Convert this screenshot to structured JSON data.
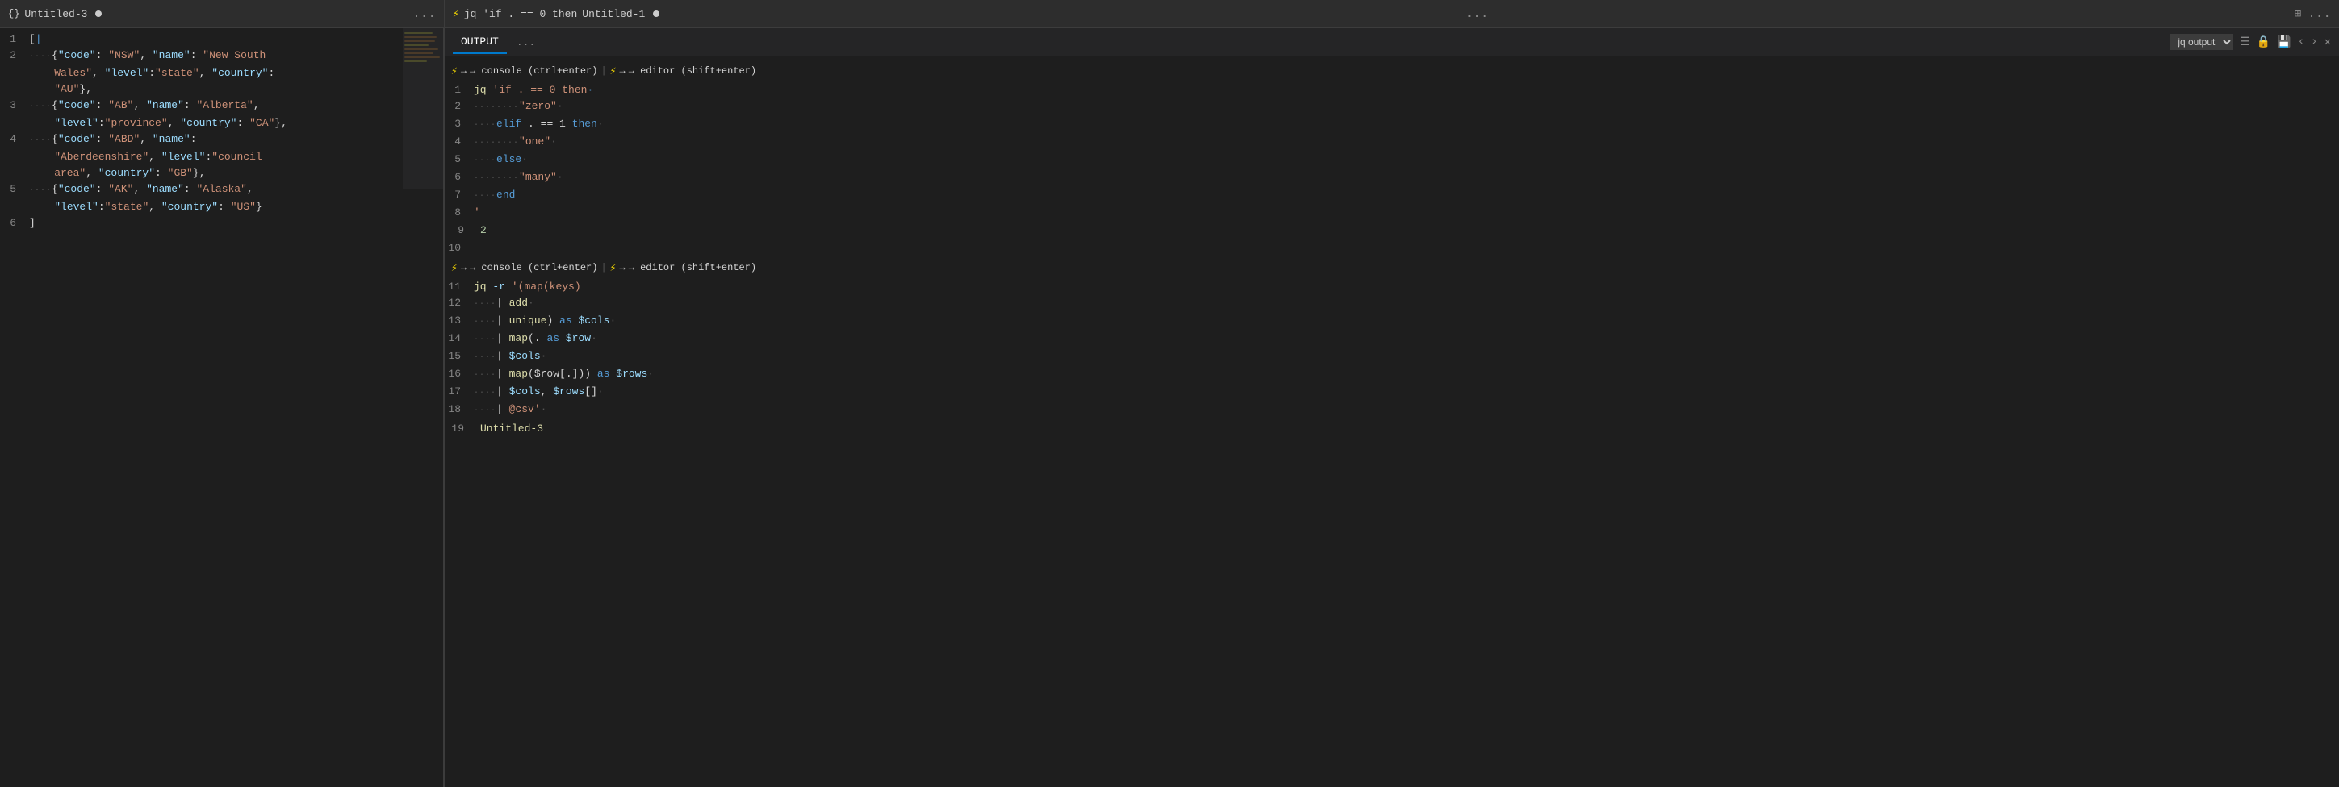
{
  "leftPanel": {
    "title": "Untitled-3",
    "modified": true,
    "icon": "{}",
    "lines": [
      {
        "num": 1,
        "content": "["
      },
      {
        "num": 2,
        "content": "    {\"code\": \"NSW\", \"name\": \"New South\\n    Wales\", \"level\":\"state\", \"country\":\\n    \"AU\"},"
      },
      {
        "num": 3,
        "content": "    {\"code\": \"AB\", \"name\": \"Alberta\",\\n    \"level\":\"province\", \"country\": \"CA\"},"
      },
      {
        "num": 4,
        "content": "    {\"code\": \"ABD\", \"name\":\\n    \"Aberdeenshire\", \"level\":\"council\\n    area\", \"country\": \"GB\"},"
      },
      {
        "num": 5,
        "content": "    {\"code\": \"AK\", \"name\": \"Alaska\",\\n    \"level\":\"state\", \"country\": \"US\"}"
      },
      {
        "num": 6,
        "content": "]"
      }
    ],
    "dotsLabel": "..."
  },
  "rightPanel": {
    "tabTitle": "jq 'if . == 0 then",
    "fileTitle": "Untitled-1",
    "modified": true,
    "splitIcon": "split",
    "dotsLabel": "...",
    "outputTabLabel": "OUTPUT",
    "outputTabDots": "...",
    "dropdownValue": "jq output",
    "promptConsole": "→ console (ctrl+enter)",
    "promptEditor": "→ editor (shift+enter)",
    "promptConsole2": "→ console (ctrl+enter)",
    "promptEditor2": "→ editor (shift+enter)",
    "codeLines1": [
      {
        "num": 1,
        "tokens": [
          {
            "t": "cmd",
            "v": "jq"
          },
          {
            "t": "space",
            "v": " "
          },
          {
            "t": "q-string",
            "v": "'if . == 0 then"
          }
        ]
      },
      {
        "num": 2,
        "tokens": [
          {
            "t": "dots",
            "v": "········"
          },
          {
            "t": "q-string",
            "v": "\"zero\""
          }
        ]
      },
      {
        "num": 3,
        "tokens": [
          {
            "t": "dots",
            "v": "····"
          },
          {
            "t": "keyword",
            "v": "elif"
          },
          {
            "t": "space",
            "v": " . == 1 "
          },
          {
            "t": "keyword",
            "v": "then"
          }
        ]
      },
      {
        "num": 4,
        "tokens": [
          {
            "t": "dots",
            "v": "········"
          },
          {
            "t": "q-string",
            "v": "\"one\""
          }
        ]
      },
      {
        "num": 5,
        "tokens": [
          {
            "t": "dots",
            "v": "····"
          },
          {
            "t": "keyword",
            "v": "else"
          }
        ]
      },
      {
        "num": 6,
        "tokens": [
          {
            "t": "dots",
            "v": "········"
          },
          {
            "t": "q-string",
            "v": "\"many\""
          }
        ]
      },
      {
        "num": 7,
        "tokens": [
          {
            "t": "dots",
            "v": "····"
          },
          {
            "t": "keyword",
            "v": "end"
          }
        ]
      },
      {
        "num": 8,
        "tokens": [
          {
            "t": "plain",
            "v": "'"
          }
        ]
      },
      {
        "num": 9,
        "tokens": [
          {
            "t": "number",
            "v": "2"
          }
        ]
      },
      {
        "num": 10,
        "tokens": []
      }
    ],
    "codeLines2": [
      {
        "num": 11,
        "tokens": [
          {
            "t": "cmd",
            "v": "jq"
          },
          {
            "t": "space",
            "v": " "
          },
          {
            "t": "flag",
            "v": "-r"
          },
          {
            "t": "space",
            "v": " "
          },
          {
            "t": "q-string",
            "v": "'(map(keys)"
          }
        ]
      },
      {
        "num": 12,
        "tokens": [
          {
            "t": "dots",
            "v": "····"
          },
          {
            "t": "pipe",
            "v": "| "
          },
          {
            "t": "func",
            "v": "add"
          }
        ]
      },
      {
        "num": 13,
        "tokens": [
          {
            "t": "dots",
            "v": "····"
          },
          {
            "t": "pipe",
            "v": "| "
          },
          {
            "t": "func",
            "v": "unique"
          },
          {
            "t": "plain",
            "v": ") "
          },
          {
            "t": "keyword",
            "v": "as"
          },
          {
            "t": "var",
            "v": " $cols"
          }
        ]
      },
      {
        "num": 14,
        "tokens": [
          {
            "t": "dots",
            "v": "····"
          },
          {
            "t": "pipe",
            "v": "| "
          },
          {
            "t": "func",
            "v": "map"
          },
          {
            "t": "plain",
            "v": "(. "
          },
          {
            "t": "keyword",
            "v": "as"
          },
          {
            "t": "var",
            "v": " $row"
          }
        ]
      },
      {
        "num": 15,
        "tokens": [
          {
            "t": "dots",
            "v": "····"
          },
          {
            "t": "pipe",
            "v": "| "
          },
          {
            "t": "var",
            "v": "$cols"
          }
        ]
      },
      {
        "num": 16,
        "tokens": [
          {
            "t": "dots",
            "v": "····"
          },
          {
            "t": "pipe",
            "v": "| "
          },
          {
            "t": "func",
            "v": "map"
          },
          {
            "t": "plain",
            "v": "($row[.])) "
          },
          {
            "t": "keyword",
            "v": "as"
          },
          {
            "t": "var",
            "v": " $rows"
          }
        ]
      },
      {
        "num": 17,
        "tokens": [
          {
            "t": "dots",
            "v": "····"
          },
          {
            "t": "pipe",
            "v": "| "
          },
          {
            "t": "var",
            "v": "$cols"
          },
          {
            "t": "plain",
            "v": ", "
          },
          {
            "t": "var",
            "v": "$rows"
          },
          {
            "t": "plain",
            "v": "[]"
          }
        ]
      },
      {
        "num": 18,
        "tokens": [
          {
            "t": "dots",
            "v": "····"
          },
          {
            "t": "pipe",
            "v": "| "
          },
          {
            "t": "plain",
            "v": "@csv'"
          }
        ]
      },
      {
        "num": 19,
        "tokens": [
          {
            "t": "filename",
            "v": "Untitled-3"
          }
        ]
      }
    ]
  }
}
